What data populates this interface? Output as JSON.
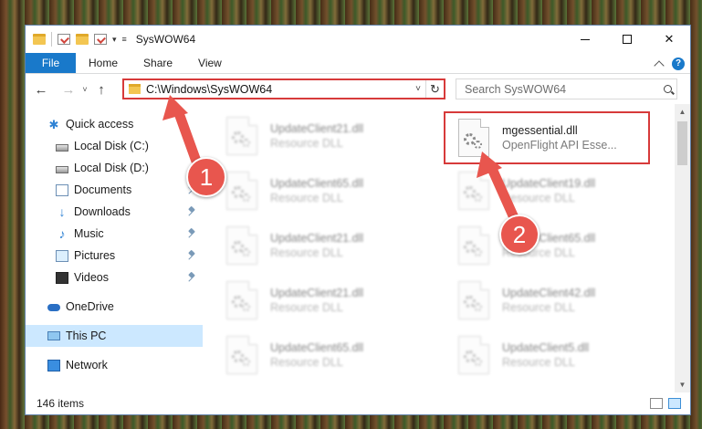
{
  "window": {
    "title": "SysWOW64"
  },
  "ribbon": {
    "tabs": [
      "File",
      "Home",
      "Share",
      "View"
    ],
    "help_label": "?"
  },
  "navigation": {
    "back_label": "←",
    "forward_label": "→",
    "recent_label": "˅",
    "up_label": "↑",
    "address_path": "C:\\Windows\\SysWOW64",
    "search_placeholder": "Search SysWOW64"
  },
  "sidebar": {
    "items": [
      {
        "label": "Quick access",
        "icon": "star-icon",
        "pinned": false
      },
      {
        "label": "Local Disk (C:)",
        "icon": "disk-icon",
        "pinned": false
      },
      {
        "label": "Local Disk (D:)",
        "icon": "disk-icon",
        "pinned": false
      },
      {
        "label": "Documents",
        "icon": "documents-icon",
        "pinned": true
      },
      {
        "label": "Downloads",
        "icon": "download-icon",
        "pinned": true
      },
      {
        "label": "Music",
        "icon": "music-icon",
        "pinned": true
      },
      {
        "label": "Pictures",
        "icon": "pictures-icon",
        "pinned": true
      },
      {
        "label": "Videos",
        "icon": "videos-icon",
        "pinned": true
      },
      {
        "label": "OneDrive",
        "icon": "cloud-icon",
        "pinned": false
      },
      {
        "label": "This PC",
        "icon": "computer-icon",
        "pinned": false,
        "selected": true
      },
      {
        "label": "Network",
        "icon": "network-icon",
        "pinned": false
      }
    ]
  },
  "files": {
    "column1": [
      {
        "name": "UpdateClient21.dll",
        "type": "Resource DLL"
      },
      {
        "name": "UpdateClient65.dll",
        "type": "Resource DLL"
      },
      {
        "name": "UpdateClient21.dll",
        "type": "Resource DLL"
      },
      {
        "name": "UpdateClient21.dll",
        "type": "Resource DLL"
      },
      {
        "name": "UpdateClient65.dll",
        "type": "Resource DLL"
      }
    ],
    "column2": [
      {
        "name": "mgessential.dll",
        "type": "OpenFlight API Esse...",
        "highlighted": true
      },
      {
        "name": "UpdateClient19.dll",
        "type": "Resource DLL"
      },
      {
        "name": "UpdateClient65.dll",
        "type": "Resource DLL"
      },
      {
        "name": "UpdateClient42.dll",
        "type": "Resource DLL"
      },
      {
        "name": "UpdateClient5.dll",
        "type": "Resource DLL"
      }
    ]
  },
  "status": {
    "item_count": "146 items"
  },
  "annotations": {
    "badge1": "1",
    "badge2": "2",
    "color": "#e8564e"
  }
}
